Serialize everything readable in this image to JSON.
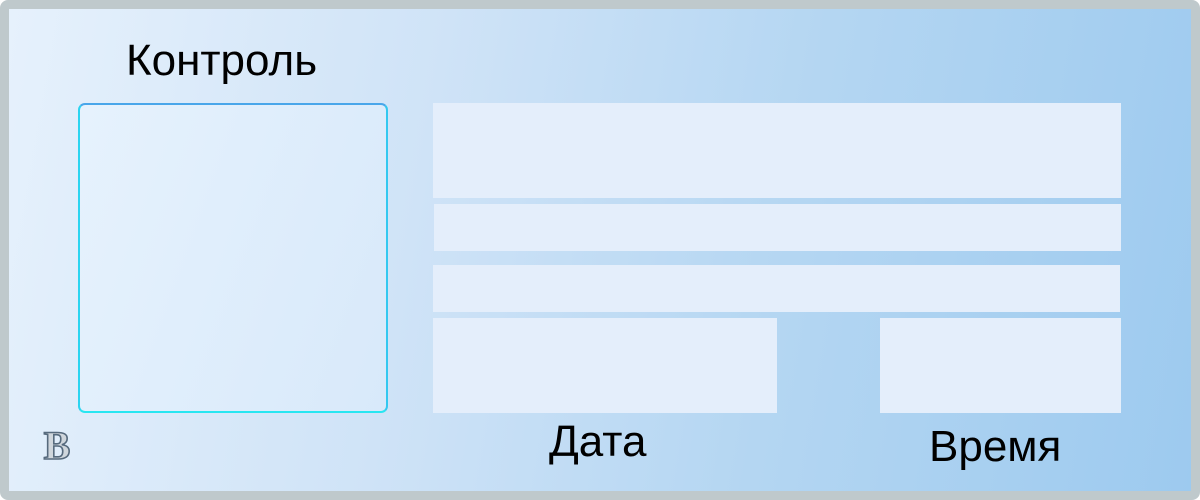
{
  "card": {
    "title": "Контроль",
    "date_label": "Дата",
    "time_label": "Время",
    "logo_letter": "B"
  },
  "colors": {
    "frame_border": "#bfc9cc",
    "field_fill": "#e4eefb",
    "photo_border_top": "#49a6ea",
    "photo_border_bottom": "#28e6f1",
    "gradient_left": "#e6f1fc",
    "gradient_right": "#9dcaef"
  },
  "icons": {
    "logo": "b-logo-icon"
  }
}
